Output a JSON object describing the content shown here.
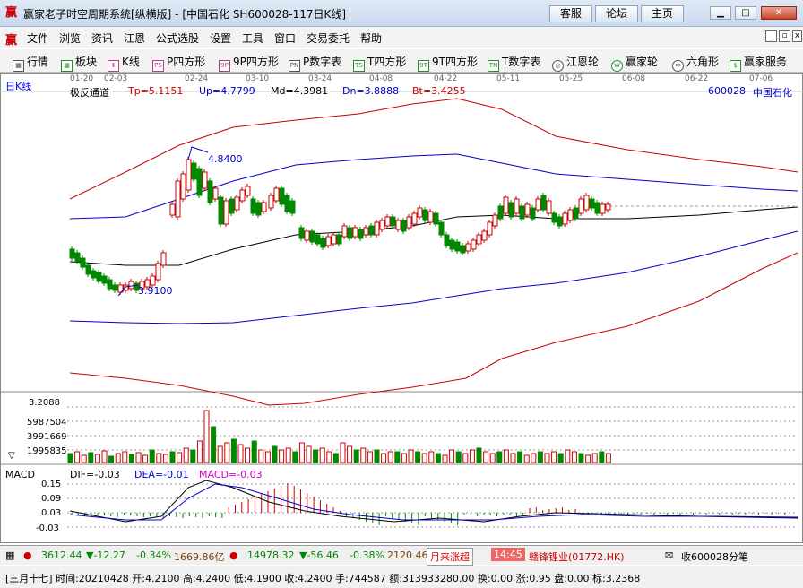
{
  "window": {
    "title": "赢家老子时空周期系统[纵横版] - [中国石化  SH600028-117日K线]",
    "buttons": [
      "客服",
      "论坛",
      "主页"
    ]
  },
  "menu": [
    "文件",
    "浏览",
    "资讯",
    "江恩",
    "公式选股",
    "设置",
    "工具",
    "窗口",
    "交易委托",
    "帮助"
  ],
  "toolbar": [
    {
      "label": "行情",
      "icon": "grid-icon"
    },
    {
      "label": "板块",
      "icon": "blocks-icon"
    },
    {
      "label": "K线",
      "icon": "candle-icon"
    },
    {
      "label": "P四方形",
      "icon": "ps-icon"
    },
    {
      "label": "9P四方形",
      "icon": "9p-icon"
    },
    {
      "label": "P数字表",
      "icon": "pn-icon"
    },
    {
      "label": "T四方形",
      "icon": "ts-icon"
    },
    {
      "label": "9T四方形",
      "icon": "9t-icon"
    },
    {
      "label": "T数字表",
      "icon": "tn-icon"
    },
    {
      "label": "江恩轮",
      "icon": "gann-wheel-icon"
    },
    {
      "label": "赢家轮",
      "icon": "winner-wheel-icon"
    },
    {
      "label": "六角形",
      "icon": "hexagon-icon"
    },
    {
      "label": "赢家服务",
      "icon": "dollar-icon"
    }
  ],
  "chart": {
    "period_label": "日K线",
    "dates": [
      "01-20",
      "02-03",
      "02-24",
      "03-10",
      "03-24",
      "04-08",
      "04-22",
      "05-11",
      "05-25",
      "06-08",
      "06-22",
      "07-06"
    ],
    "indicator": "极反通道",
    "tp": "Tp=5.1151",
    "up": "Up=4.7799",
    "md": "Md=4.3981",
    "dn": "Dn=3.8888",
    "bt": "Bt=3.4255",
    "code": "600028",
    "name": "中国石化",
    "high_mark": "4.8400",
    "low_mark": "3.9100",
    "vol_axis": [
      "3.2088",
      "5987504",
      "3991669",
      "1995835"
    ],
    "macd_title": "MACD",
    "dif": "DIF=-0.03",
    "dea": "DEA=-0.01",
    "macd": "MACD=-0.03",
    "macd_axis": [
      "0.15",
      "0.09",
      "0.03",
      "-0.03"
    ]
  },
  "status1": {
    "sh_index": "3612.44",
    "sh_change": "▼-12.27",
    "sh_pct": "-0.34%",
    "sh_amount": "1669.86亿",
    "sz_index": "14978.32",
    "sz_change": "▼-56.46",
    "sz_pct": "-0.38%",
    "sz_amount": "2120.46",
    "ticker_label": "月来涨超",
    "ticker_time": "14:45",
    "ticker_news": "赣锋锂业(01772.HK)",
    "fav": "收600028分笔"
  },
  "status2": {
    "text": "[三月十七] 时间:20210428 开:4.2100 高:4.2400 低:4.1900 收:4.2400 手:744587 额:313933280.00 换:0.00 涨:0.95 盘:0.00 标:3.2368"
  }
}
